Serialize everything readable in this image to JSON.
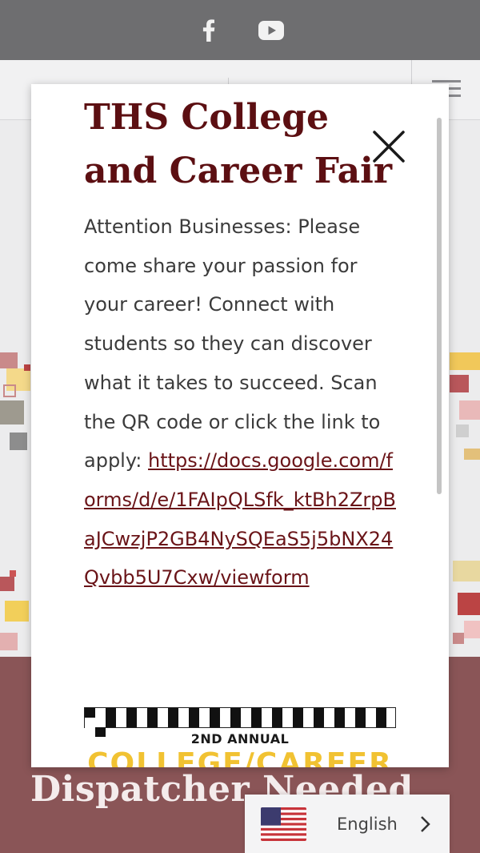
{
  "topbar": {
    "icons": [
      "facebook-icon",
      "youtube-icon"
    ],
    "background": "#6e6e70"
  },
  "modal": {
    "title": "THS College and Career Fair",
    "body_text": "Attention Businesses: Please come share your passion for your career! Connect with students so they can discover what it takes to succeed. Scan the QR code or click the link to apply: ",
    "link_text": "https://docs.google.com/forms/d/e/1FAIpQLSfk_ktBh2ZrpBaJCwzjP2GB4NySQEaS5j5bNX24Qvbb5U7Cxw/viewform",
    "close_icon": "close-icon",
    "flyer": {
      "subtitle": "2ND ANNUAL",
      "headline": "COLLEGE/CAREER"
    },
    "title_color": "#5c0f12",
    "link_color": "#6a1418"
  },
  "background_page": {
    "band_title": "Dispatcher Needed",
    "band_color": "#8a5557"
  },
  "language": {
    "label": "English",
    "flag_icon": "us-flag-icon",
    "chevron_icon": "chevron-right-icon"
  }
}
